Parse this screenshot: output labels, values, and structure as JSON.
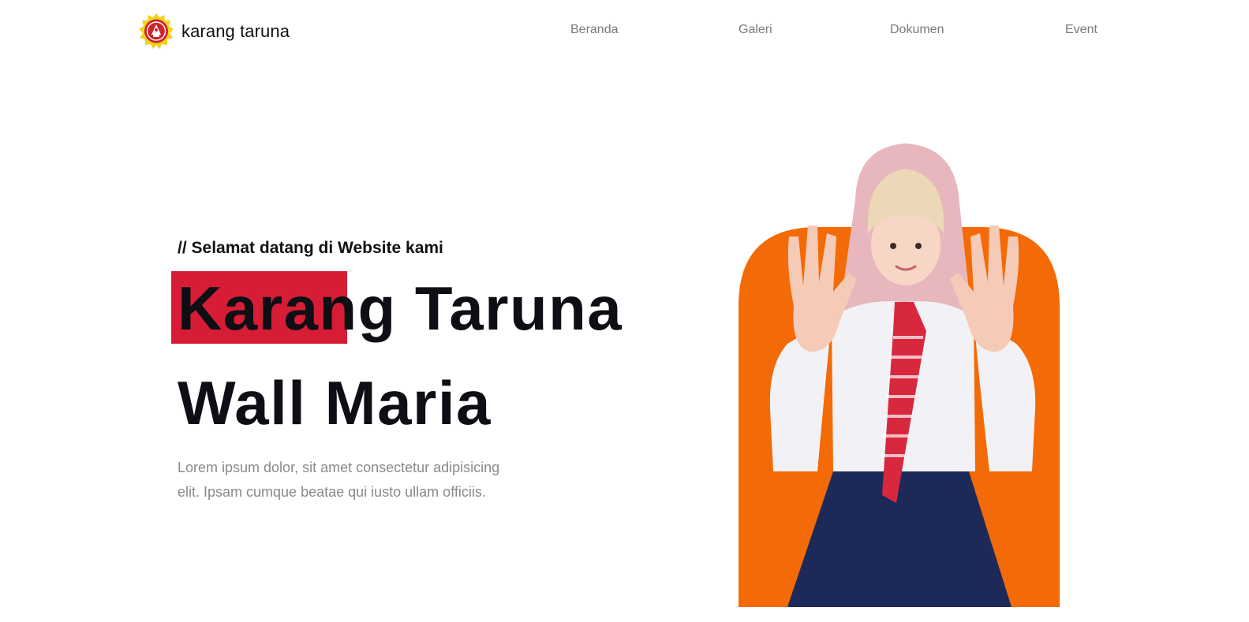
{
  "brand": {
    "name": "karang taruna",
    "logo_icon": "karang-taruna-emblem-icon"
  },
  "nav": {
    "items": [
      {
        "label": "Beranda"
      },
      {
        "label": "Galeri"
      },
      {
        "label": "Dokumen"
      },
      {
        "label": "Event"
      }
    ]
  },
  "hero": {
    "eyebrow": "// Selamat datang di Website kami",
    "title_line1": "Karang Taruna",
    "title_line2": "Wall Maria",
    "description": "Lorem ipsum dolor, sit amet consectetur adipisicing elit. Ipsam cumque beatae qui iusto ullam officiis.",
    "photo": "person-in-school-uniform-waving"
  },
  "colors": {
    "accent_red": "#d61d35",
    "accent_orange": "#f46a06",
    "text_dark": "#0d0f14",
    "text_muted": "#8a8a8a",
    "nav_text": "#7a7a7a",
    "logo_yellow": "#f3d21b"
  }
}
